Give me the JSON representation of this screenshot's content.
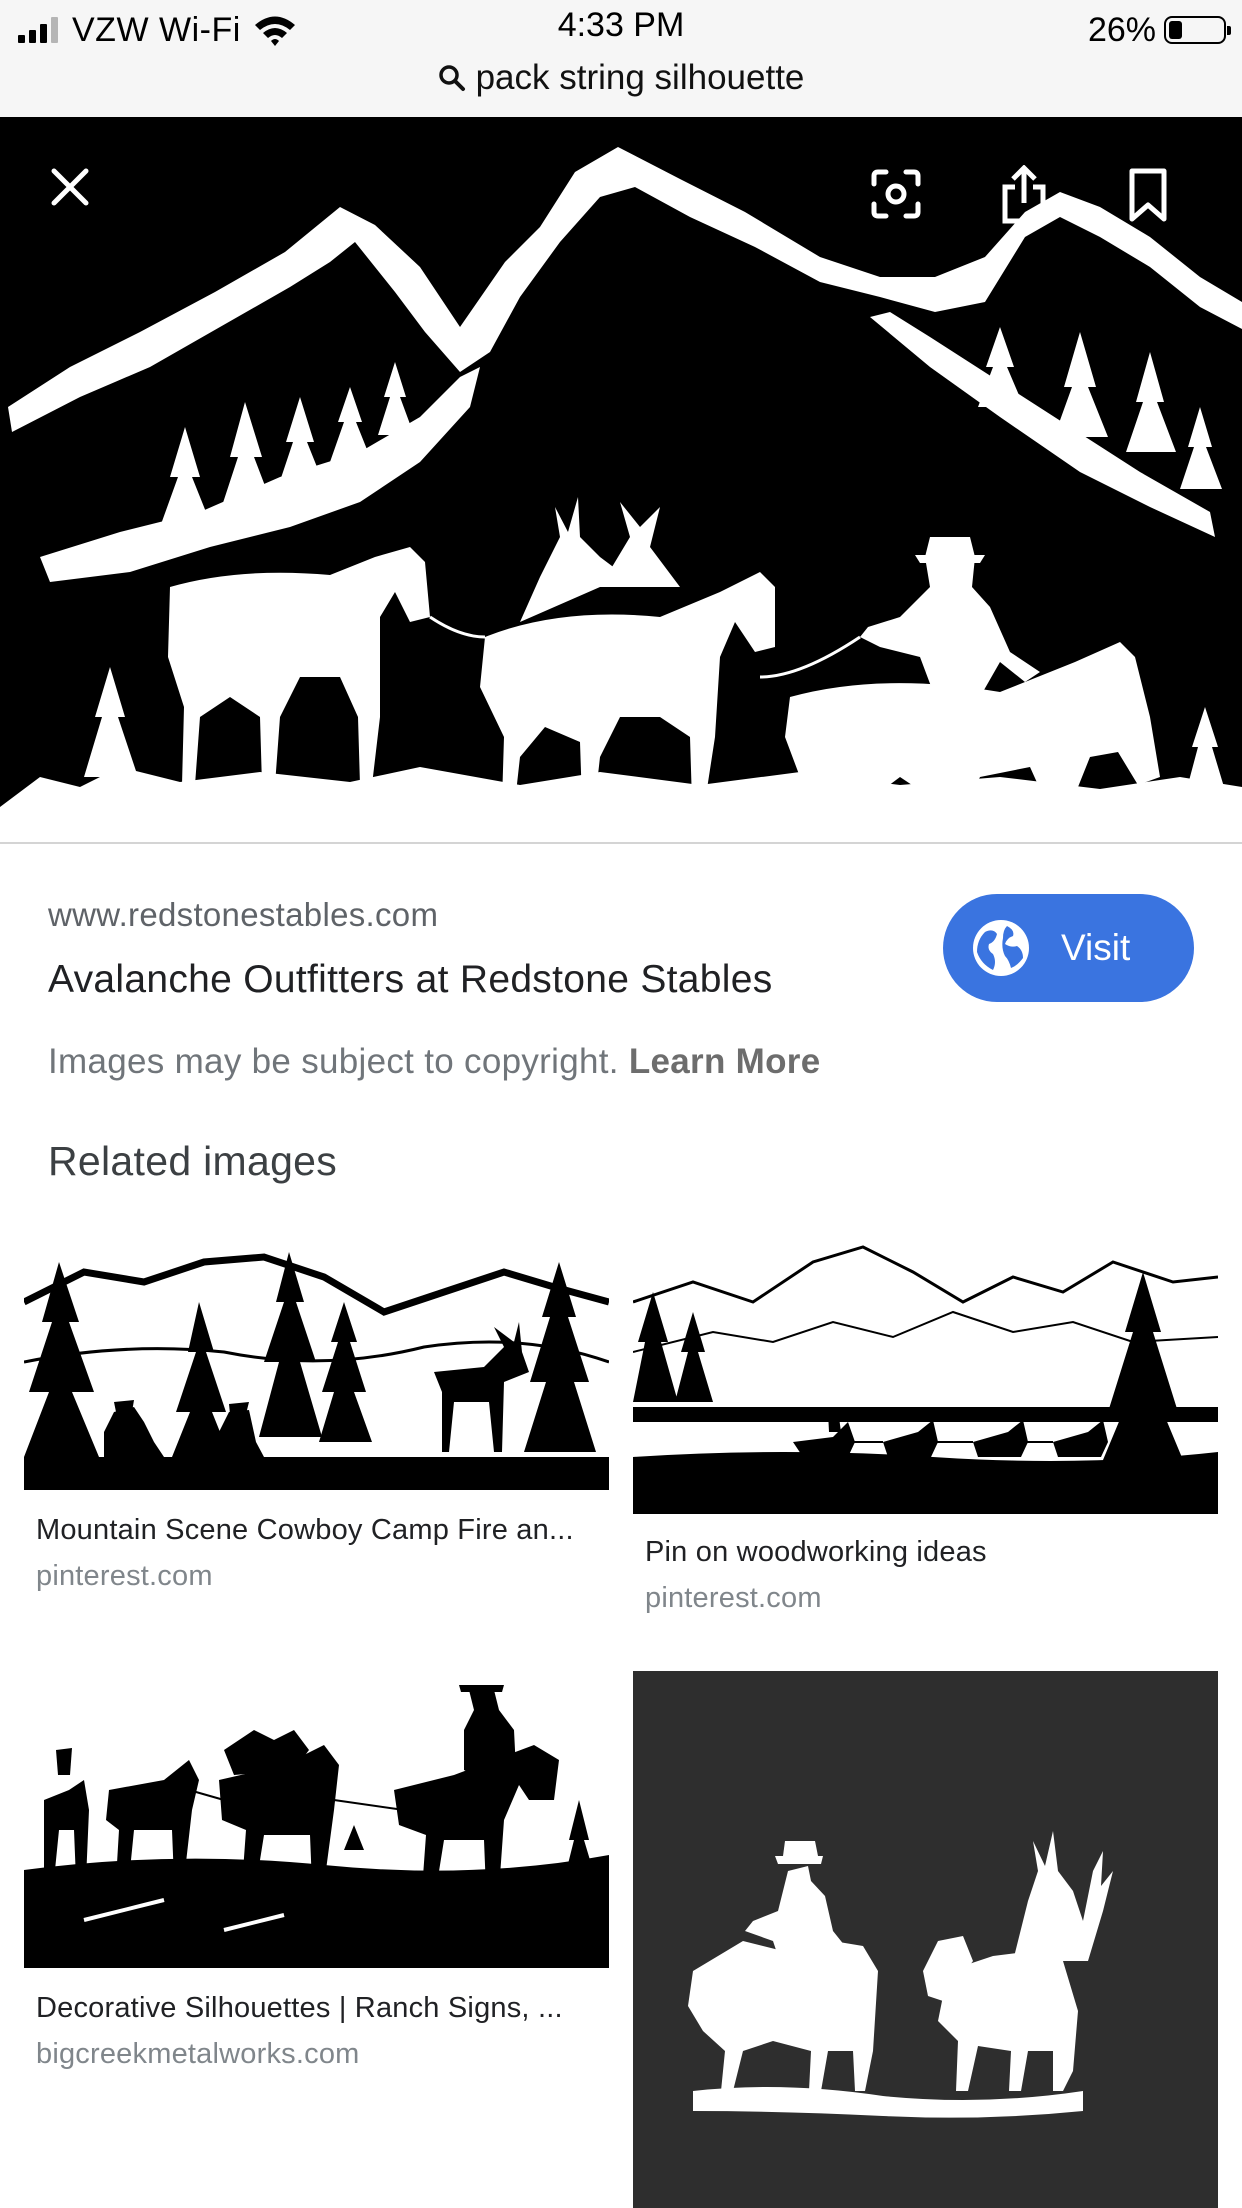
{
  "status_bar": {
    "carrier": "VZW Wi-Fi",
    "time": "4:33 PM",
    "battery_percent": "26%",
    "battery_level": 0.26
  },
  "search": {
    "query": "pack string silhouette"
  },
  "viewer": {
    "icons": [
      "close-icon",
      "lens-icon",
      "share-icon",
      "bookmark-icon"
    ]
  },
  "result": {
    "domain": "www.redstonestables.com",
    "title": "Avalanche Outfitters at Redstone Stables",
    "visit_label": "Visit",
    "copyright_text": "Images may be subject to copyright. ",
    "learn_more": "Learn More",
    "accent_color": "#3a74e0"
  },
  "related": {
    "heading": "Related images",
    "items": [
      {
        "caption": "Mountain Scene Cowboy Camp Fire an...",
        "source": "pinterest.com"
      },
      {
        "caption": "Pin on woodworking ideas",
        "source": "pinterest.com"
      },
      {
        "caption": "Decorative Silhouettes | Ranch Signs, ...",
        "source": "bigcreekmetalworks.com"
      },
      {
        "caption": "",
        "source": ""
      }
    ]
  }
}
